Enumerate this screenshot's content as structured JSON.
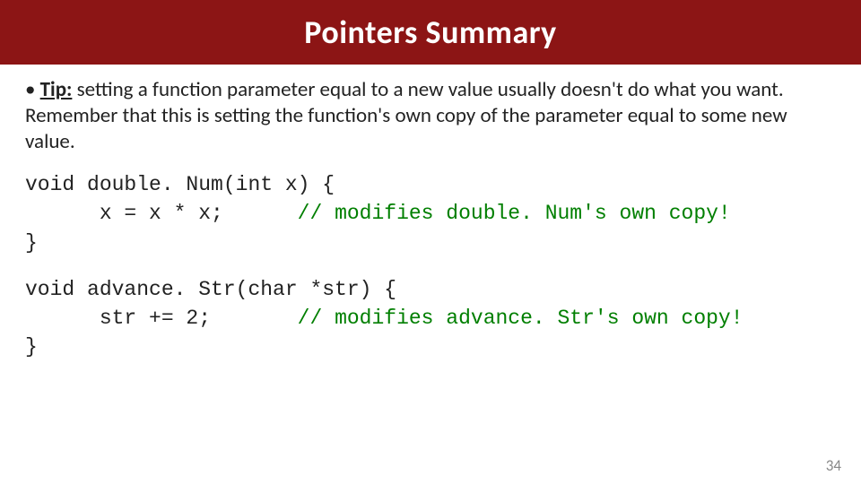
{
  "title": "Pointers Summary",
  "bullet": {
    "marker": "• ",
    "tip_label": "Tip:",
    "rest": " setting a function parameter equal to a new value usually doesn't do what you want.  Remember that this is setting the function's own copy of the parameter equal to some new value."
  },
  "code1": {
    "l1": "void double. Num(int x) {",
    "l2_code": "      x = x * x;      ",
    "l2_comment": "// modifies double. Num's own copy!",
    "l3": "}"
  },
  "code2": {
    "l1": "void advance. Str(char *str) {",
    "l2_code": "      str += 2;       ",
    "l2_comment": "// modifies advance. Str's own copy!",
    "l3": "}"
  },
  "page_number": "34"
}
